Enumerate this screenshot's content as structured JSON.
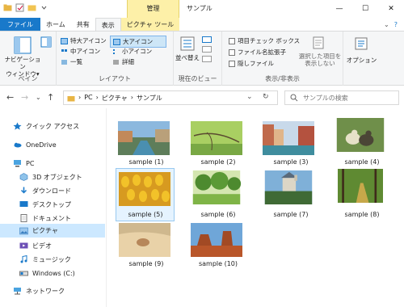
{
  "window": {
    "title": "サンプル",
    "manage_tab": "管理",
    "controls": {
      "minimize": "—",
      "maximize": "☐",
      "close": "✕"
    }
  },
  "tabs": {
    "file": "ファイル",
    "home": "ホーム",
    "share": "共有",
    "view": "表示",
    "picture_tools": "ピクチャ ツール"
  },
  "ribbon": {
    "pane": {
      "navigation_pane": "ナビゲーション\nウィンドウ▾",
      "label": "ペイン"
    },
    "layout": {
      "label": "レイアウト",
      "options": [
        "特大アイコン",
        "大アイコン",
        "中アイコン",
        "小アイコン",
        "一覧",
        "詳細"
      ],
      "selected": "大アイコン"
    },
    "current_view": {
      "sort_by": "並べ替え",
      "label": "現在のビュー"
    },
    "show_hide": {
      "label": "表示/非表示",
      "checkboxes": [
        "項目チェック ボックス",
        "ファイル名拡張子",
        "隠しファイル"
      ],
      "hide_selected": "選択した項目を\n表示しない"
    },
    "options": {
      "label": "オプション"
    }
  },
  "address": {
    "crumbs": [
      "PC",
      "ピクチャ",
      "サンプル"
    ],
    "search_placeholder": "サンプルの検索"
  },
  "sidebar": {
    "items": [
      {
        "label": "クイック アクセス",
        "icon": "star-icon"
      },
      {
        "label": "OneDrive",
        "icon": "cloud-icon"
      },
      {
        "label": "PC",
        "icon": "computer-icon"
      },
      {
        "label": "3D オブジェクト",
        "icon": "cube-icon"
      },
      {
        "label": "ダウンロード",
        "icon": "download-icon"
      },
      {
        "label": "デスクトップ",
        "icon": "desktop-icon"
      },
      {
        "label": "ドキュメント",
        "icon": "document-icon"
      },
      {
        "label": "ピクチャ",
        "icon": "pictures-icon"
      },
      {
        "label": "ビデオ",
        "icon": "video-icon"
      },
      {
        "label": "ミュージック",
        "icon": "music-icon"
      },
      {
        "label": "Windows (C:)",
        "icon": "drive-icon"
      },
      {
        "label": "ネットワーク",
        "icon": "network-icon"
      }
    ],
    "selected": "ピクチャ"
  },
  "files": [
    {
      "name": "sample (1)",
      "scene": "canal city"
    },
    {
      "name": "sample (2)",
      "scene": "green branches"
    },
    {
      "name": "sample (3)",
      "scene": "venice canal"
    },
    {
      "name": "sample (4)",
      "scene": "ducklings"
    },
    {
      "name": "sample (5)",
      "scene": "yellow tulips"
    },
    {
      "name": "sample (6)",
      "scene": "park trees"
    },
    {
      "name": "sample (7)",
      "scene": "castle"
    },
    {
      "name": "sample (8)",
      "scene": "forest path"
    },
    {
      "name": "sample (9)",
      "scene": "sand shell"
    },
    {
      "name": "sample (10)",
      "scene": "desert butte"
    }
  ],
  "selected_file": "sample (5)",
  "colors": {
    "accent": "#1979ca",
    "selection": "#cce8ff",
    "picture_tools": "#fdf0a8"
  }
}
